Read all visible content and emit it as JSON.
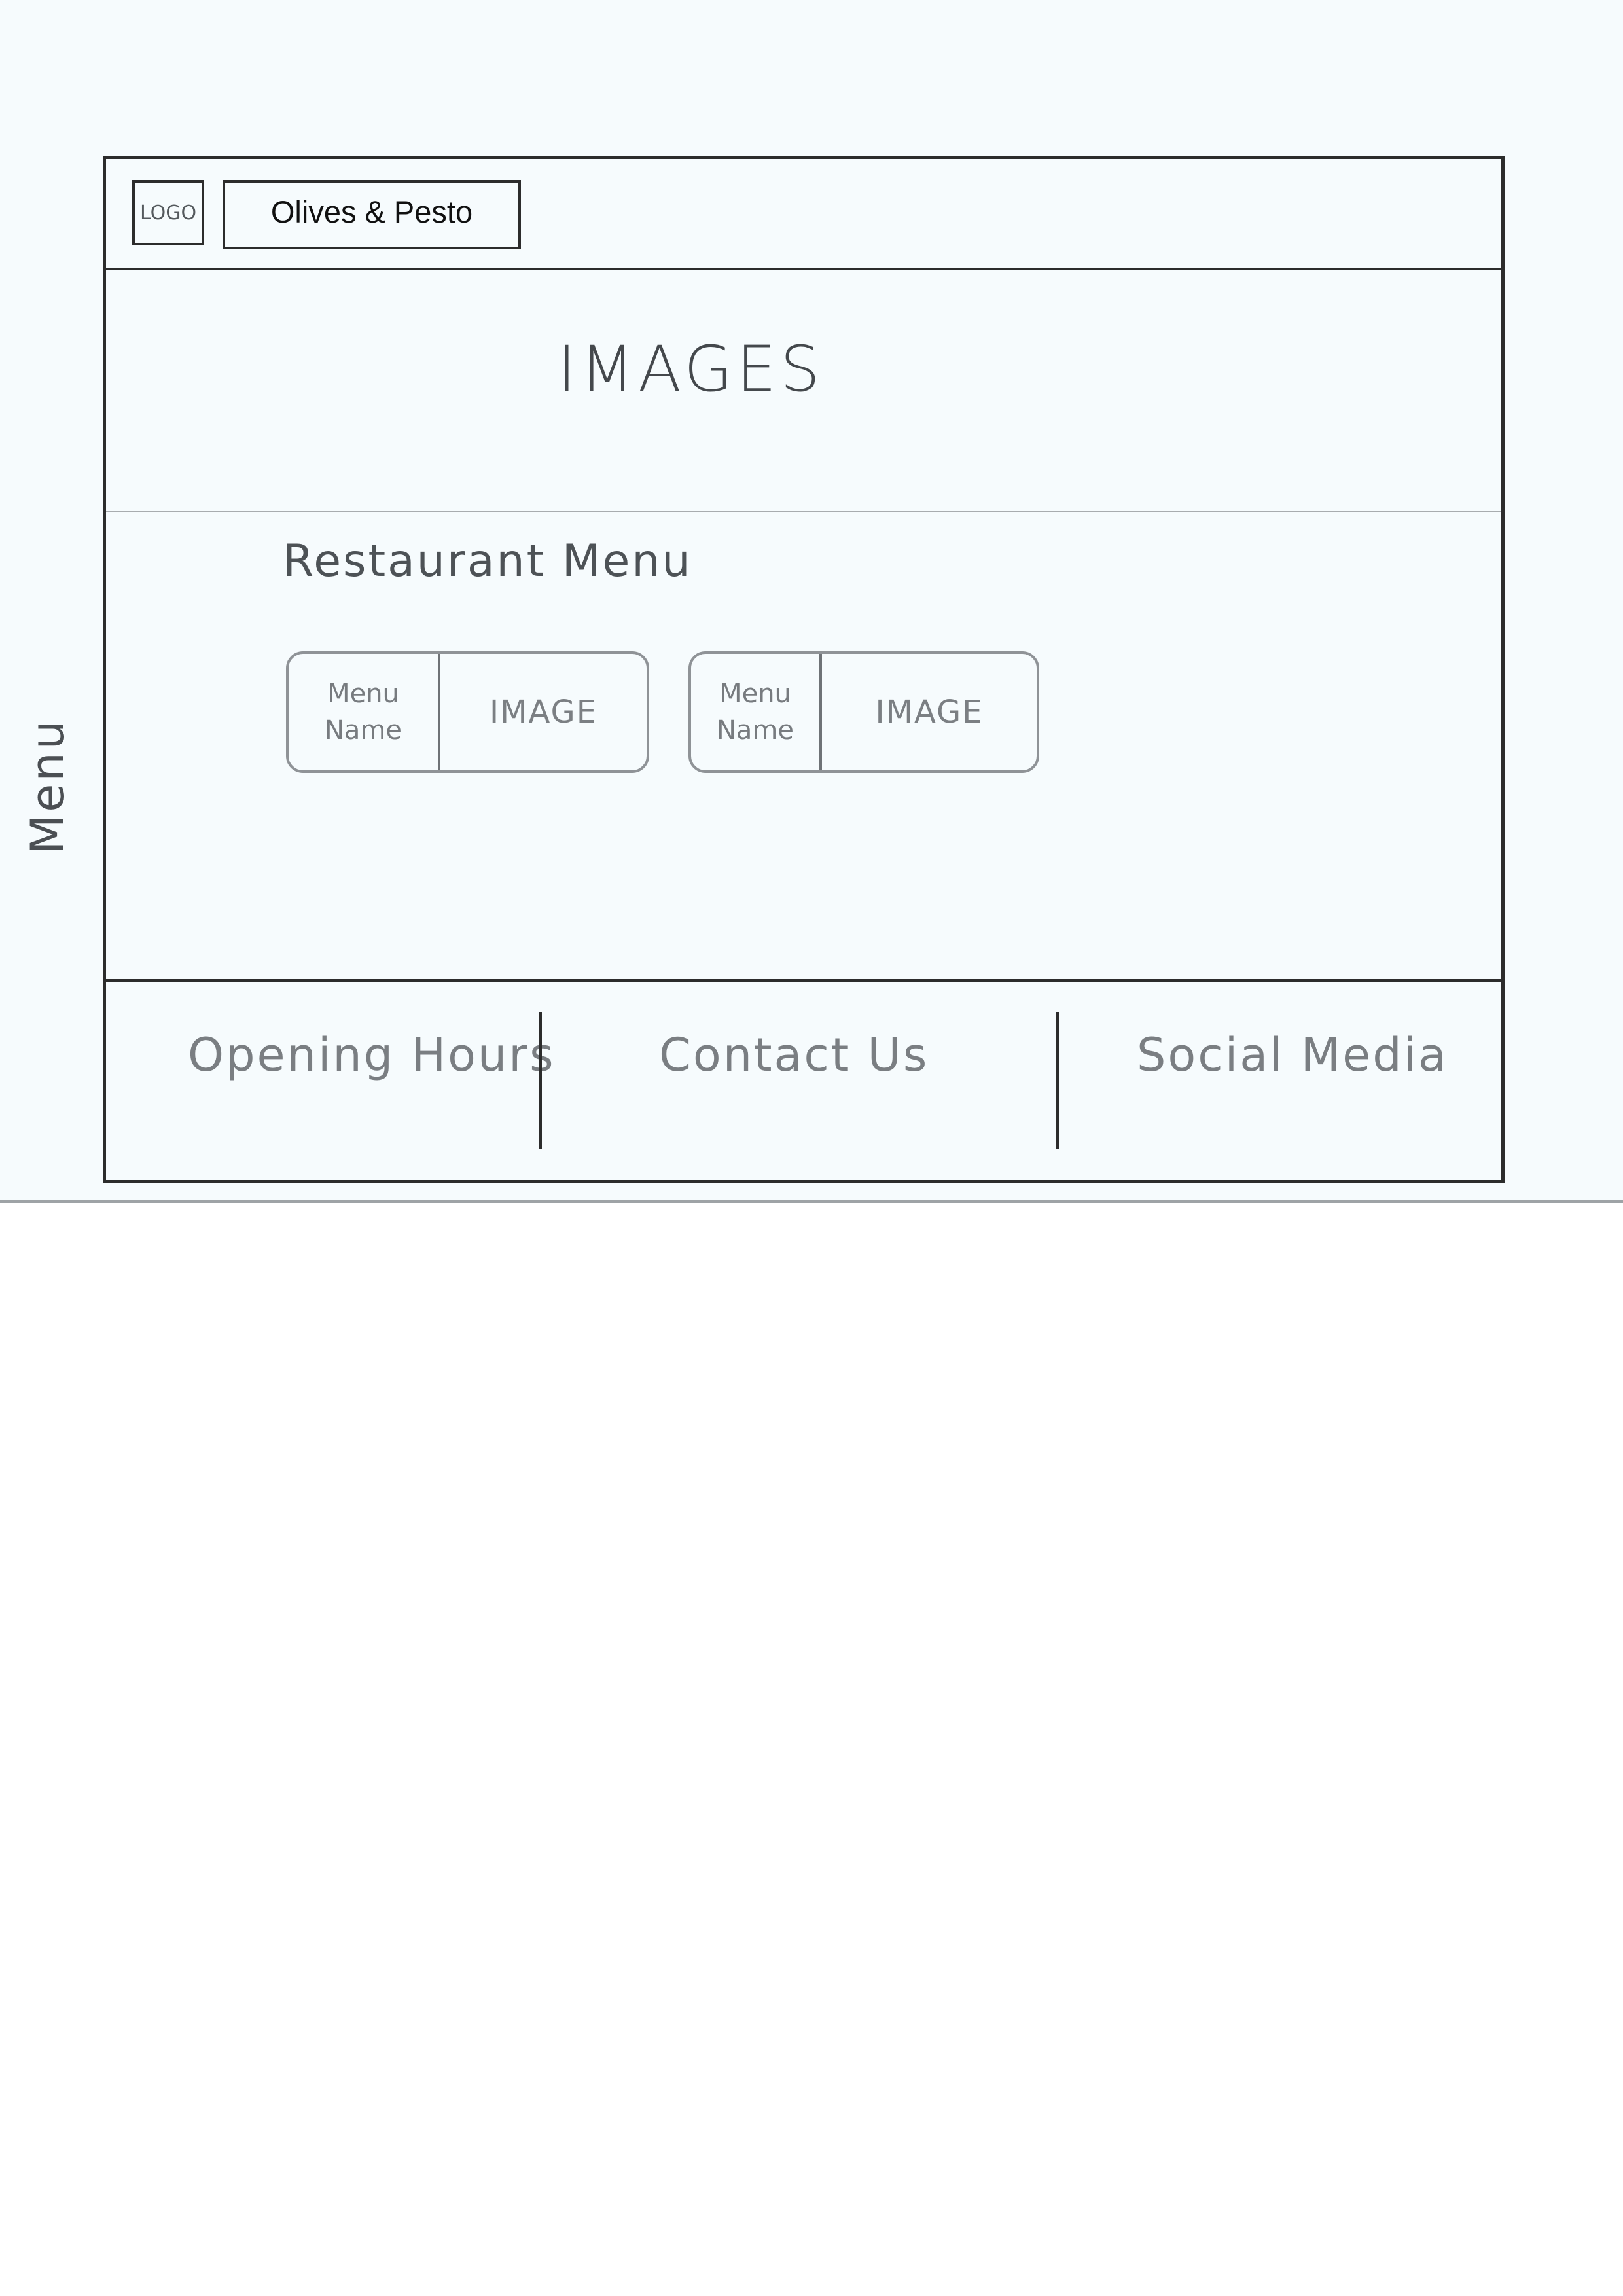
{
  "side_nav": {
    "label": "Menu"
  },
  "header": {
    "logo": "LOGO",
    "brand": "Olives & Pesto"
  },
  "hero": {
    "label": "IMAGES"
  },
  "menu_section": {
    "title": "Restaurant Menu",
    "cards": [
      {
        "name_line1": "Menu",
        "name_line2": "Name",
        "image_label": "IMAGE"
      },
      {
        "name_line1": "Menu",
        "name_line2": "Name",
        "image_label": "IMAGE"
      }
    ]
  },
  "footer": {
    "items": [
      "Opening Hours",
      "Contact Us",
      "Social Media"
    ]
  }
}
